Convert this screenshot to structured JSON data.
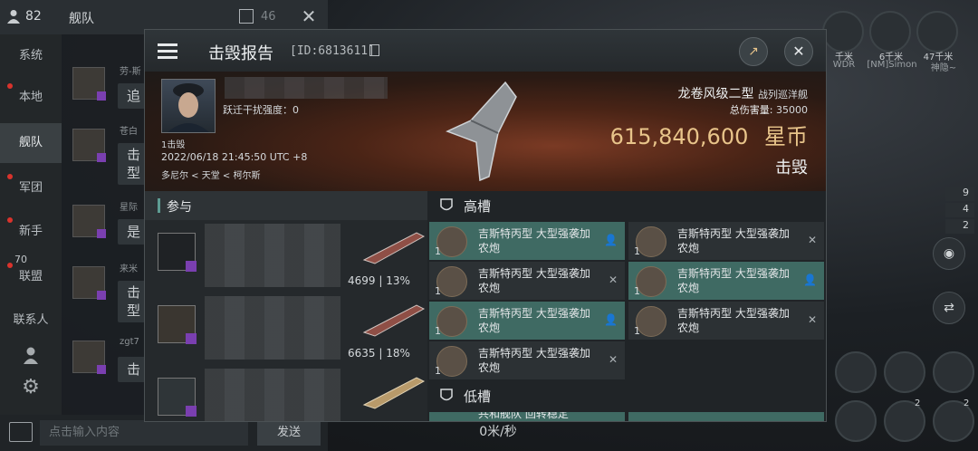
{
  "chat": {
    "member_count": "82",
    "channel_title": "舰队",
    "unread_count": "46",
    "nav": [
      {
        "label": "系统"
      },
      {
        "label": "本地"
      },
      {
        "label": "舰队"
      },
      {
        "label": "军团"
      },
      {
        "label": "新手"
      },
      {
        "label": "联盟"
      },
      {
        "label": "联系人"
      }
    ],
    "nav_badge": "70",
    "messages": [
      {
        "name": "劳-斯",
        "text": "追"
      },
      {
        "name": "苍白",
        "text": "击型"
      },
      {
        "name": "星际",
        "text": "是"
      },
      {
        "name": "来米",
        "text": "击型"
      },
      {
        "name": "zgt7",
        "text": "击"
      }
    ],
    "input_placeholder": "点击输入内容",
    "send_label": "发送"
  },
  "hud": {
    "speed": "0米/秒",
    "targets": [
      {
        "dist": "千米",
        "name": "WDR"
      },
      {
        "dist": "6千米",
        "name": "[NM]Simon"
      },
      {
        "dist": "47千米",
        "name": "神隐~"
      }
    ],
    "counters": [
      "9",
      "4",
      "2"
    ],
    "module_counts": [
      "2",
      "2"
    ]
  },
  "report": {
    "title": "击毁报告",
    "report_id": "[ID:6813611]",
    "pilot": {
      "kills": "1击毁",
      "warp_disrupt": "跃迁干扰强度：0",
      "datetime": "2022/06/18 21:45:50 UTC +8",
      "location": "多尼尔 < 天堂 < 柯尔斯"
    },
    "ship": {
      "name": "龙卷风级二型",
      "class": "战列巡洋舰",
      "damage_label": "总伤害量:",
      "damage_value": "35000",
      "value": "615,840,600",
      "currency": "星币",
      "result": "击毁"
    },
    "participants_label": "参与",
    "participants": [
      {
        "stats": "4699 | 13%"
      },
      {
        "stats": "6635 | 18%"
      },
      {
        "stats": ""
      }
    ],
    "high_slots_label": "高槽",
    "low_slots_label": "低槽",
    "high_slots": [
      {
        "qty": "1",
        "name": "吉斯特丙型 大型强袭加农炮",
        "state": "highlight",
        "action": "person"
      },
      {
        "qty": "1",
        "name": "吉斯特丙型 大型强袭加农炮",
        "state": "normal",
        "action": "x"
      },
      {
        "qty": "1",
        "name": "吉斯特丙型 大型强袭加农炮",
        "state": "normal",
        "action": "x"
      },
      {
        "qty": "1",
        "name": "吉斯特丙型 大型强袭加农炮",
        "state": "highlight",
        "action": "person"
      },
      {
        "qty": "1",
        "name": "吉斯特丙型 大型强袭加农炮",
        "state": "highlight",
        "action": "person"
      },
      {
        "qty": "1",
        "name": "吉斯特丙型 大型强袭加农炮",
        "state": "normal",
        "action": "x"
      },
      {
        "qty": "1",
        "name": "吉斯特丙型 大型强袭加农炮",
        "state": "normal",
        "action": "x"
      }
    ],
    "low_slot_partial": "共和舰队 回转稳定"
  },
  "colors": {
    "accent_teal": "#3f6a63",
    "gold": "#e8c48a",
    "purple_badge": "#7a3fb0"
  }
}
